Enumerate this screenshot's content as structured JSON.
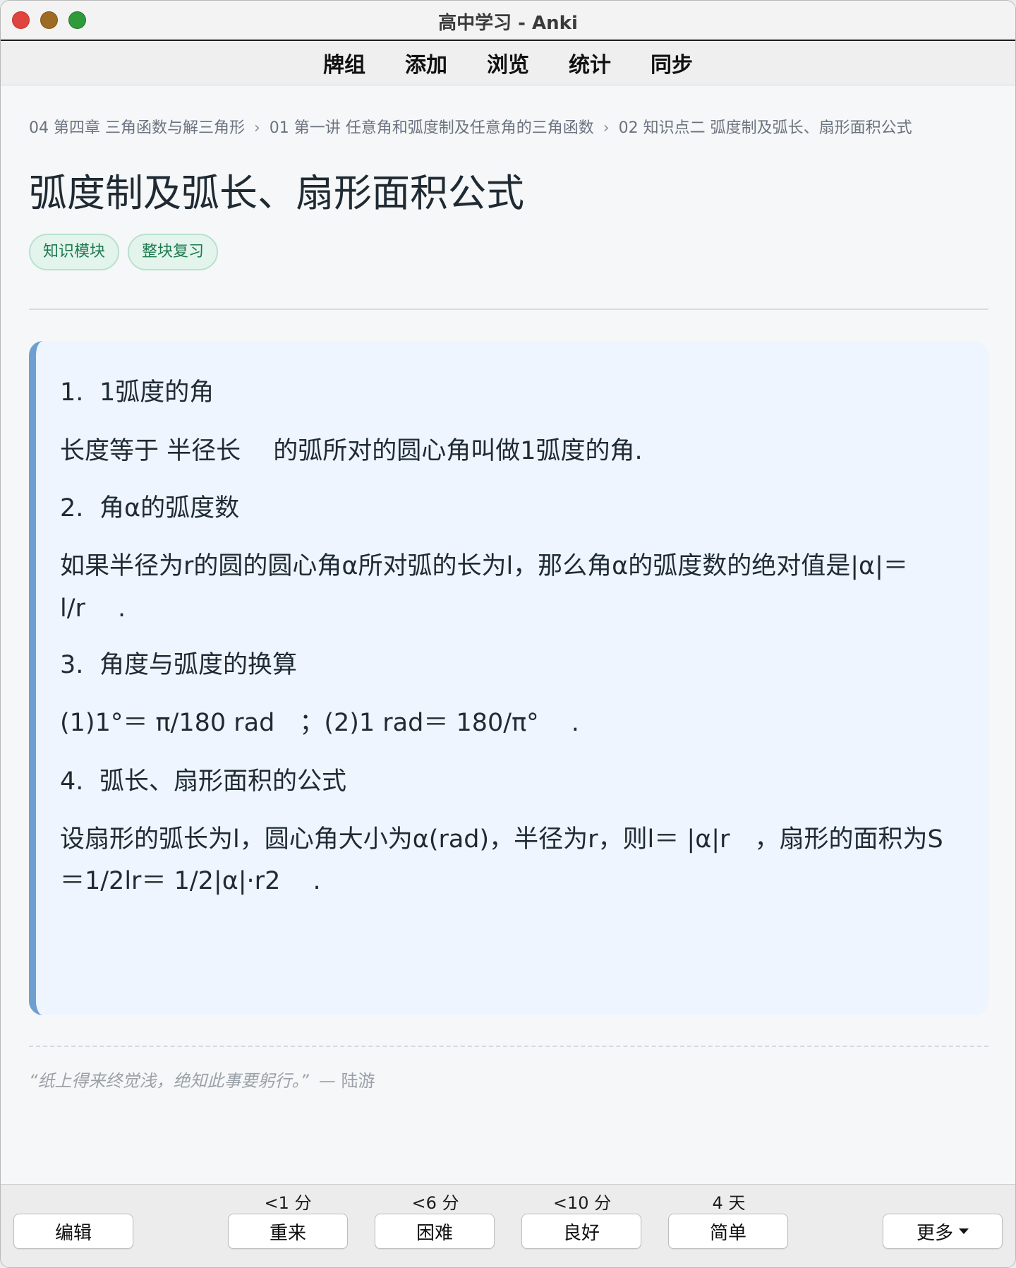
{
  "window": {
    "title": "高中学习 - Anki"
  },
  "toolbar": {
    "items": [
      "牌组",
      "添加",
      "浏览",
      "统计",
      "同步"
    ]
  },
  "breadcrumb": {
    "items": [
      "04 第四章 三角函数与解三角形",
      "01 第一讲 任意角和弧度制及任意角的三角函数",
      "02 知识点二 弧度制及弧长、扇形面积公式"
    ],
    "separator": "›"
  },
  "page": {
    "title": "弧度制及弧长、扇形面积公式",
    "tags": [
      "知识模块",
      "整块复习"
    ]
  },
  "card": {
    "h1_num": "1.",
    "h1_text": "1弧度的角",
    "p1": "长度等于 半径长　 的弧所对的圆心角叫做1弧度的角.",
    "h2_num": "2.",
    "h2_text": "角α的弧度数",
    "p2a": "如果半径为r的圆的圆心角α所对弧的长为l，那么角α的弧度数的绝对值是|α|＝",
    "p2b": "l/r　 .",
    "h3_num": "3.",
    "h3_text": "角度与弧度的换算",
    "p3": "(1)1°＝ π/180 rad　；(2)1 rad＝ 180/π°　 .",
    "h4_num": "4.",
    "h4_text": "弧长、扇形面积的公式",
    "p4a": "设扇形的弧长为l，圆心角大小为α(rad)，半径为r，则l＝ |α|r　，扇形的面积为S",
    "p4b": "＝1/2lr＝ 1/2|α|·r2　 ."
  },
  "quote": {
    "text": "“纸上得来终觉浅，绝知此事要躬行。”",
    "author": "— 陆游"
  },
  "bottom": {
    "edit_label": "编辑",
    "answers": [
      {
        "due": "<1 分",
        "label": "重来"
      },
      {
        "due": "<6 分",
        "label": "困难"
      },
      {
        "due": "<10 分",
        "label": "良好"
      },
      {
        "due": "4 天",
        "label": "简单"
      }
    ],
    "more_label": "更多"
  },
  "colors": {
    "accent_bar": "#6f9fd0",
    "card_bg": "#eef5ff",
    "tag_bg": "#e3f4ec",
    "tag_text": "#1e7a4f",
    "close": "#e0443e",
    "minimize": "#9e6b25",
    "zoom": "#2f9a3a"
  }
}
